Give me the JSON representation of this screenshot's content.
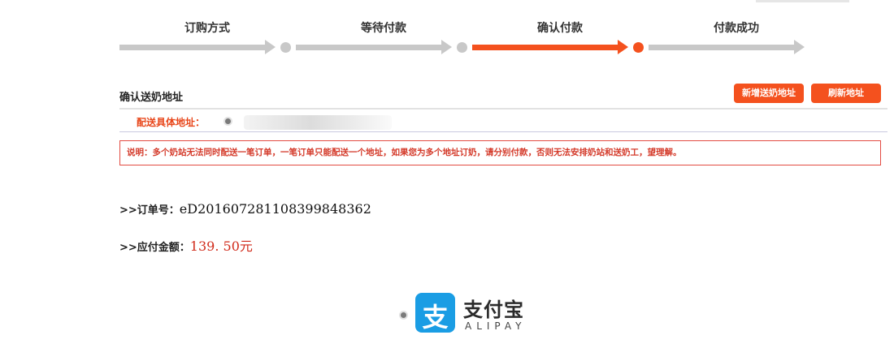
{
  "steps": [
    {
      "label": "订购方式",
      "state": "done"
    },
    {
      "label": "等待付款",
      "state": "done"
    },
    {
      "label": "确认付款",
      "state": "current"
    },
    {
      "label": "付款成功",
      "state": "pending"
    }
  ],
  "colors": {
    "accent": "#f4511e",
    "inactive": "#c8c8c8",
    "notice_text": "#d43a2a",
    "amount": "#d12b1b",
    "alipay_blue": "#1a9de4"
  },
  "address": {
    "title": "确认送奶地址",
    "add_button": "新增送奶地址",
    "refresh_button": "刷新地址",
    "detail_label": "配送具体地址："
  },
  "notice": "说明：多个奶站无法同时配送一笔订单，一笔订单只能配送一个地址，如果您为多个地址订奶，请分别付款，否则无法安排奶站和送奶工，望理解。",
  "order": {
    "number_label": ">>订单号：",
    "number_value": "eD20160728110839984836​2",
    "amount_label": ">>应付金额：",
    "amount_value": "139. 50元"
  },
  "payment": {
    "logo_glyph": "支",
    "logo_cn": "支付宝",
    "logo_en": "ALIPAY"
  }
}
